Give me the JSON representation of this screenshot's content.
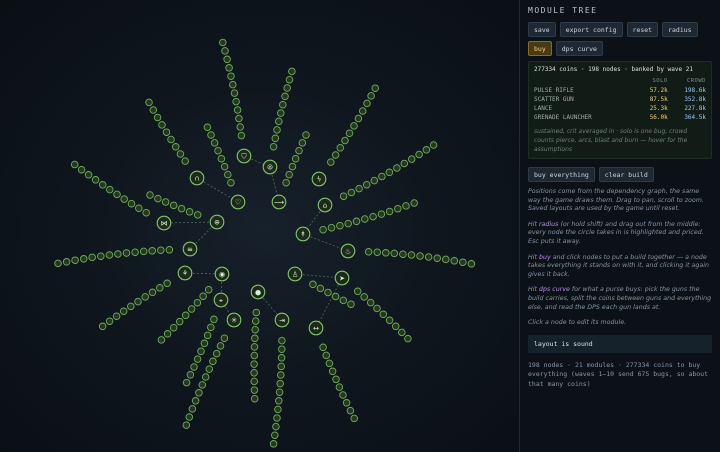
{
  "panel": {
    "title": "MODULE TREE",
    "buttons": {
      "save": "save",
      "export": "export config",
      "reset": "reset",
      "radius": "radius",
      "buy": "buy",
      "dps": "dps curve"
    },
    "stats": {
      "header": "277334 coins · 198 nodes · banked by wave 21",
      "col_solo": "SOLO",
      "col_crowd": "CROWD",
      "rows": [
        {
          "name": "PULSE RIFLE",
          "solo": "57.2k",
          "crowd": "198.6k"
        },
        {
          "name": "SCATTER GUN",
          "solo": "87.5k",
          "crowd": "352.8k"
        },
        {
          "name": "LANCE",
          "solo": "25.3k",
          "crowd": "227.8k"
        },
        {
          "name": "GRENADE LAUNCHER",
          "solo": "56.0k",
          "crowd": "364.5k"
        }
      ],
      "note": "sustained, crit averaged in · solo is one bug, crowd counts pierce, arcs, blast and burn — hover for the assumptions"
    },
    "actions": {
      "buy_everything": "buy everything",
      "clear_build": "clear build"
    },
    "help": {
      "p1": "Positions come from the dependency graph, the same way the game draws them. Drag to pan, scroll to zoom. Saved layouts are used by the game until reset.",
      "p2_a": "Hit ",
      "p2_hl": "radius",
      "p2_b": " (or hold shift) and drag out from the middle: every node the circle takes in is highlighted and priced. Esc puts it away.",
      "p3_a": "Hit ",
      "p3_hl": "buy",
      "p3_b": " and click nodes to put a build together — a node takes everything it stands on with it, and clicking it again gives it back.",
      "p4_a": "Hit ",
      "p4_hl": "dps curve",
      "p4_b": " for what a purse buys: pick the guns the build carries, split the coins between guns and everything else, and read the DPS each gun lands at.",
      "p5": "Click a node to edit its module."
    },
    "status": "layout is sound",
    "summary": "198 nodes · 21 modules · 277334 coins to buy everything (waves 1–10 send 675 bugs, so about that many coins)"
  },
  "graph": {
    "colors": {
      "node_fill": "#26361f",
      "node_stroke": "#6fae5c",
      "module_fill": "#1c2a1a",
      "module_stroke": "#86c36f",
      "icon": "#d8ecd2",
      "dash": "#4c6a5a"
    },
    "modules": [
      {
        "name": "shield",
        "icon": "shield-icon"
      },
      {
        "name": "grip",
        "icon": "grip-icon"
      },
      {
        "name": "lightning",
        "icon": "lightning-icon"
      },
      {
        "name": "headphones",
        "icon": "headphones-icon"
      },
      {
        "name": "heart",
        "icon": "heart-icon"
      },
      {
        "name": "rifle",
        "icon": "rifle-icon"
      },
      {
        "name": "drone",
        "icon": "drone-icon"
      },
      {
        "name": "target",
        "icon": "target-icon"
      },
      {
        "name": "list",
        "icon": "list-icon"
      },
      {
        "name": "spread",
        "icon": "spread-icon"
      },
      {
        "name": "lance",
        "icon": "lance-icon"
      },
      {
        "name": "flame",
        "icon": "flame-icon"
      },
      {
        "name": "fire",
        "icon": "fire-icon"
      },
      {
        "name": "eye",
        "icon": "eye-icon"
      },
      {
        "name": "runner",
        "icon": "runner-icon"
      },
      {
        "name": "crosshair",
        "icon": "crosshair-icon"
      },
      {
        "name": "grenade",
        "icon": "grenade-icon"
      },
      {
        "name": "rocket",
        "icon": "rocket-icon"
      },
      {
        "name": "blast",
        "icon": "blast-icon"
      },
      {
        "name": "arrow",
        "icon": "arrow-icon"
      },
      {
        "name": "range",
        "icon": "range-icon"
      }
    ]
  }
}
